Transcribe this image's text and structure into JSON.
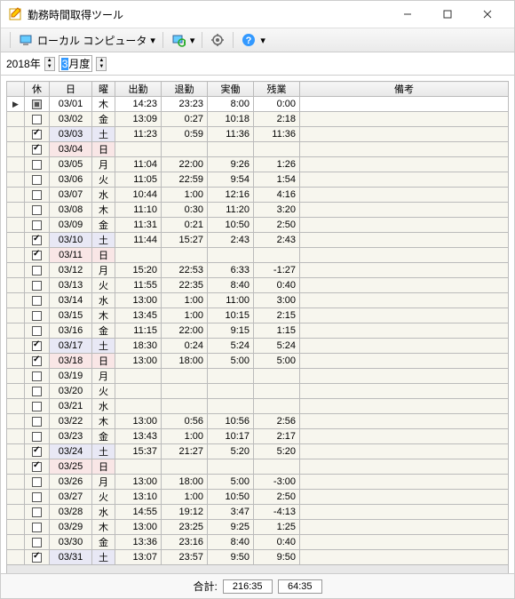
{
  "window": {
    "title": "勤務時間取得ツール"
  },
  "toolbar": {
    "target_label": "ローカル コンピュータ"
  },
  "period": {
    "year": "2018年",
    "month_prefix": "3",
    "month_suffix": "月度"
  },
  "headers": {
    "chk": "休",
    "date": "日",
    "dow": "曜",
    "in": "出勤",
    "out": "退勤",
    "work": "実働",
    "ot": "残業",
    "note": "備考"
  },
  "rows": [
    {
      "chk": "ind",
      "date": "03/01",
      "dow": "木",
      "in": "14:23",
      "out": "23:23",
      "work": "8:00",
      "ot": "0:00",
      "type": "first"
    },
    {
      "chk": "off",
      "date": "03/02",
      "dow": "金",
      "in": "13:09",
      "out": "0:27",
      "work": "10:18",
      "ot": "2:18",
      "type": "n"
    },
    {
      "chk": "on",
      "date": "03/03",
      "dow": "土",
      "in": "11:23",
      "out": "0:59",
      "work": "11:36",
      "ot": "11:36",
      "type": "sat"
    },
    {
      "chk": "on",
      "date": "03/04",
      "dow": "日",
      "in": "",
      "out": "",
      "work": "",
      "ot": "",
      "type": "sun"
    },
    {
      "chk": "off",
      "date": "03/05",
      "dow": "月",
      "in": "11:04",
      "out": "22:00",
      "work": "9:26",
      "ot": "1:26",
      "type": "n"
    },
    {
      "chk": "off",
      "date": "03/06",
      "dow": "火",
      "in": "11:05",
      "out": "22:59",
      "work": "9:54",
      "ot": "1:54",
      "type": "n"
    },
    {
      "chk": "off",
      "date": "03/07",
      "dow": "水",
      "in": "10:44",
      "out": "1:00",
      "work": "12:16",
      "ot": "4:16",
      "type": "n"
    },
    {
      "chk": "off",
      "date": "03/08",
      "dow": "木",
      "in": "11:10",
      "out": "0:30",
      "work": "11:20",
      "ot": "3:20",
      "type": "n"
    },
    {
      "chk": "off",
      "date": "03/09",
      "dow": "金",
      "in": "11:31",
      "out": "0:21",
      "work": "10:50",
      "ot": "2:50",
      "type": "n"
    },
    {
      "chk": "on",
      "date": "03/10",
      "dow": "土",
      "in": "11:44",
      "out": "15:27",
      "work": "2:43",
      "ot": "2:43",
      "type": "sat"
    },
    {
      "chk": "on",
      "date": "03/11",
      "dow": "日",
      "in": "",
      "out": "",
      "work": "",
      "ot": "",
      "type": "sun"
    },
    {
      "chk": "off",
      "date": "03/12",
      "dow": "月",
      "in": "15:20",
      "out": "22:53",
      "work": "6:33",
      "ot": "-1:27",
      "type": "n"
    },
    {
      "chk": "off",
      "date": "03/13",
      "dow": "火",
      "in": "11:55",
      "out": "22:35",
      "work": "8:40",
      "ot": "0:40",
      "type": "n"
    },
    {
      "chk": "off",
      "date": "03/14",
      "dow": "水",
      "in": "13:00",
      "out": "1:00",
      "work": "11:00",
      "ot": "3:00",
      "type": "n"
    },
    {
      "chk": "off",
      "date": "03/15",
      "dow": "木",
      "in": "13:45",
      "out": "1:00",
      "work": "10:15",
      "ot": "2:15",
      "type": "n"
    },
    {
      "chk": "off",
      "date": "03/16",
      "dow": "金",
      "in": "11:15",
      "out": "22:00",
      "work": "9:15",
      "ot": "1:15",
      "type": "n"
    },
    {
      "chk": "on",
      "date": "03/17",
      "dow": "土",
      "in": "18:30",
      "out": "0:24",
      "work": "5:24",
      "ot": "5:24",
      "type": "sat"
    },
    {
      "chk": "on",
      "date": "03/18",
      "dow": "日",
      "in": "13:00",
      "out": "18:00",
      "work": "5:00",
      "ot": "5:00",
      "type": "sun"
    },
    {
      "chk": "off",
      "date": "03/19",
      "dow": "月",
      "in": "",
      "out": "",
      "work": "",
      "ot": "",
      "type": "n"
    },
    {
      "chk": "off",
      "date": "03/20",
      "dow": "火",
      "in": "",
      "out": "",
      "work": "",
      "ot": "",
      "type": "n"
    },
    {
      "chk": "off",
      "date": "03/21",
      "dow": "水",
      "in": "",
      "out": "",
      "work": "",
      "ot": "",
      "type": "n"
    },
    {
      "chk": "off",
      "date": "03/22",
      "dow": "木",
      "in": "13:00",
      "out": "0:56",
      "work": "10:56",
      "ot": "2:56",
      "type": "n"
    },
    {
      "chk": "off",
      "date": "03/23",
      "dow": "金",
      "in": "13:43",
      "out": "1:00",
      "work": "10:17",
      "ot": "2:17",
      "type": "n"
    },
    {
      "chk": "on",
      "date": "03/24",
      "dow": "土",
      "in": "15:37",
      "out": "21:27",
      "work": "5:20",
      "ot": "5:20",
      "type": "sat"
    },
    {
      "chk": "on",
      "date": "03/25",
      "dow": "日",
      "in": "",
      "out": "",
      "work": "",
      "ot": "",
      "type": "sun"
    },
    {
      "chk": "off",
      "date": "03/26",
      "dow": "月",
      "in": "13:00",
      "out": "18:00",
      "work": "5:00",
      "ot": "-3:00",
      "type": "n"
    },
    {
      "chk": "off",
      "date": "03/27",
      "dow": "火",
      "in": "13:10",
      "out": "1:00",
      "work": "10:50",
      "ot": "2:50",
      "type": "n"
    },
    {
      "chk": "off",
      "date": "03/28",
      "dow": "水",
      "in": "14:55",
      "out": "19:12",
      "work": "3:47",
      "ot": "-4:13",
      "type": "n"
    },
    {
      "chk": "off",
      "date": "03/29",
      "dow": "木",
      "in": "13:00",
      "out": "23:25",
      "work": "9:25",
      "ot": "1:25",
      "type": "n"
    },
    {
      "chk": "off",
      "date": "03/30",
      "dow": "金",
      "in": "13:36",
      "out": "23:16",
      "work": "8:40",
      "ot": "0:40",
      "type": "n"
    },
    {
      "chk": "on",
      "date": "03/31",
      "dow": "土",
      "in": "13:07",
      "out": "23:57",
      "work": "9:50",
      "ot": "9:50",
      "type": "sat"
    }
  ],
  "footer": {
    "label": "合計:",
    "work_total": "216:35",
    "ot_total": "64:35"
  }
}
